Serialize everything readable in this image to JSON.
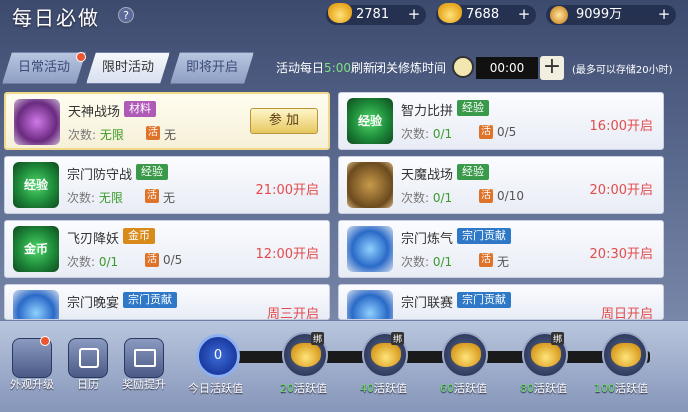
{
  "header": {
    "title": "每日必做",
    "help": "?"
  },
  "resources": [
    {
      "icon": "gold-ingot-icon",
      "value": "2781"
    },
    {
      "icon": "bound-gold-ingot-icon",
      "value": "7688"
    },
    {
      "icon": "copper-coin-icon",
      "value": "9099万"
    }
  ],
  "tabs": [
    {
      "label": "日常活动",
      "active": false,
      "red_dot": true
    },
    {
      "label": "限时活动",
      "active": true,
      "red_dot": false
    },
    {
      "label": "即将开启",
      "active": false,
      "red_dot": false
    }
  ],
  "cultivation": {
    "daily_prefix": "活动每日",
    "refresh_time": "5:00",
    "refresh_suffix": "刷新",
    "closed_label": "闭关修炼时间",
    "time_value": "00:00",
    "max_note": "(最多可以存储20小时)"
  },
  "activities": [
    {
      "name": "天神战场",
      "tag": "材料",
      "tag_type": "cailiao",
      "count_label": "次数:",
      "count": "无限",
      "huo": "活",
      "huo_value": "无",
      "action": "参 加",
      "time": "",
      "highlight": true,
      "icon": "purple-crystal-icon"
    },
    {
      "name": "智力比拼",
      "tag": "经验",
      "tag_type": "jingyan",
      "count_label": "次数:",
      "count": "0/1",
      "huo": "活",
      "huo_value": "0/5",
      "action": "",
      "time": "16:00开启",
      "highlight": false,
      "icon": "exp-orb-icon"
    },
    {
      "name": "宗门防守战",
      "tag": "经验",
      "tag_type": "jingyan",
      "count_label": "次数:",
      "count": "无限",
      "huo": "活",
      "huo_value": "无",
      "action": "",
      "time": "21:00开启",
      "highlight": false,
      "icon": "exp-orb-icon"
    },
    {
      "name": "天魔战场",
      "tag": "经验",
      "tag_type": "jingyan",
      "count_label": "次数:",
      "count": "0/1",
      "huo": "活",
      "huo_value": "0/10",
      "action": "",
      "time": "20:00开启",
      "highlight": false,
      "icon": "gold-crystal-icon"
    },
    {
      "name": "飞刃降妖",
      "tag": "金币",
      "tag_type": "jinbi",
      "count_label": "次数:",
      "count": "0/1",
      "huo": "活",
      "huo_value": "0/5",
      "action": "",
      "time": "12:00开启",
      "highlight": false,
      "icon": "exp-orb-icon"
    },
    {
      "name": "宗门炼气",
      "tag": "宗门贡献",
      "tag_type": "gongxian",
      "count_label": "次数:",
      "count": "0/1",
      "huo": "活",
      "huo_value": "无",
      "action": "",
      "time": "20:30开启",
      "highlight": false,
      "icon": "blue-crystal-icon"
    },
    {
      "name": "宗门晚宴",
      "tag": "宗门贡献",
      "tag_type": "gongxian",
      "count_label": "次数:",
      "count": "",
      "huo": "",
      "huo_value": "",
      "action": "",
      "time": "周三开启",
      "highlight": false,
      "icon": "blue-crystal-icon"
    },
    {
      "name": "宗门联赛",
      "tag": "宗门贡献",
      "tag_type": "gongxian",
      "count_label": "次数:",
      "count": "",
      "huo": "",
      "huo_value": "",
      "action": "",
      "time": "周日开启",
      "highlight": false,
      "icon": "blue-crystal-icon"
    }
  ],
  "bottom_buttons": [
    {
      "label": "外观升级",
      "icon": "appearance-icon",
      "red_dot": true
    },
    {
      "label": "日历",
      "icon": "calendar-icon",
      "red_dot": false
    },
    {
      "label": "奖励提升",
      "icon": "gift-box-icon",
      "red_dot": false
    }
  ],
  "activity_progress": {
    "current_value": "0",
    "current_label": "今日活跃值",
    "milestones": [
      {
        "value": "20",
        "label": "活跃值",
        "bound": "绑"
      },
      {
        "value": "40",
        "label": "活跃值",
        "bound": "绑"
      },
      {
        "value": "60",
        "label": "活跃值",
        "bound": ""
      },
      {
        "value": "80",
        "label": "活跃值",
        "bound": "绑"
      },
      {
        "value": "100",
        "label": "活跃值",
        "bound": ""
      }
    ]
  }
}
